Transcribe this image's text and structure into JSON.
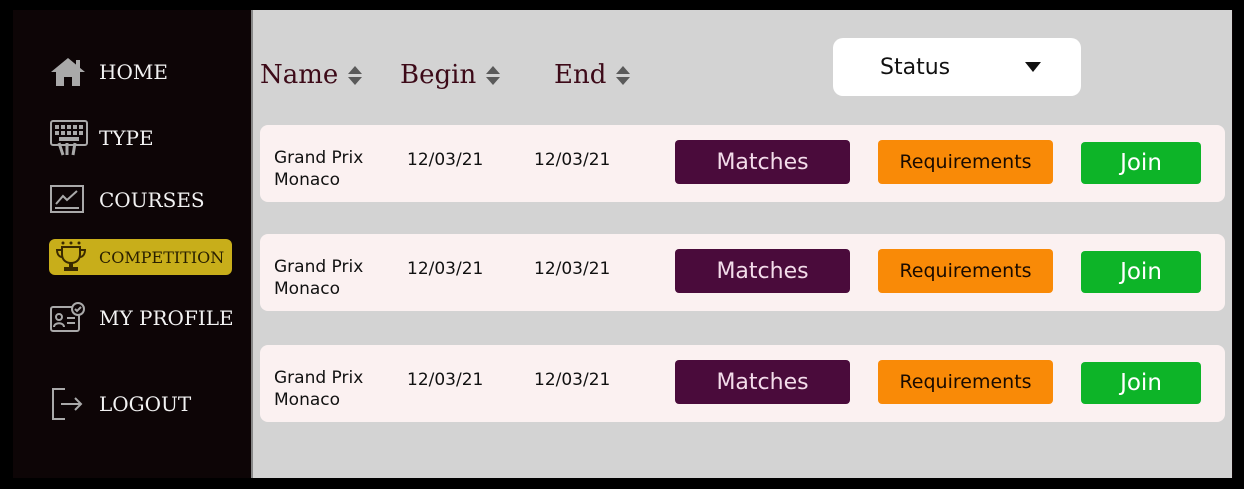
{
  "sidebar": {
    "items": [
      {
        "label": "HOME",
        "icon": "home-icon"
      },
      {
        "label": "TYPE",
        "icon": "keyboard-icon"
      },
      {
        "label": "COURSES",
        "icon": "chart-board-icon"
      },
      {
        "label": "COMPETITION",
        "icon": "trophy-icon",
        "active": true
      },
      {
        "label": "MY PROFILE",
        "icon": "id-card-icon"
      },
      {
        "label": "LOGOUT",
        "icon": "logout-icon"
      }
    ]
  },
  "table": {
    "headers": [
      "Name",
      "Begin",
      "End"
    ],
    "status_filter": {
      "label": "Status"
    },
    "rows": [
      {
        "name_line1": "Grand Prix",
        "name_line2": "Monaco",
        "begin": "12/03/21",
        "end": "12/03/21",
        "matches": "Matches",
        "requirements": "Requirements",
        "join": "Join"
      },
      {
        "name_line1": "Grand Prix",
        "name_line2": "Monaco",
        "begin": "12/03/21",
        "end": "12/03/21",
        "matches": "Matches",
        "requirements": "Requirements",
        "join": "Join"
      },
      {
        "name_line1": "Grand Prix",
        "name_line2": "Monaco",
        "begin": "12/03/21",
        "end": "12/03/21",
        "matches": "Matches",
        "requirements": "Requirements",
        "join": "Join"
      }
    ]
  },
  "colors": {
    "sidebar_bg": "#0d0506",
    "active_item": "#c8ae1a",
    "matches_button": "#4a0b3b",
    "requirements_button": "#f98a07",
    "join_button": "#0db428",
    "content_bg": "#d3d3d3",
    "row_bg": "#fbf1f1"
  }
}
